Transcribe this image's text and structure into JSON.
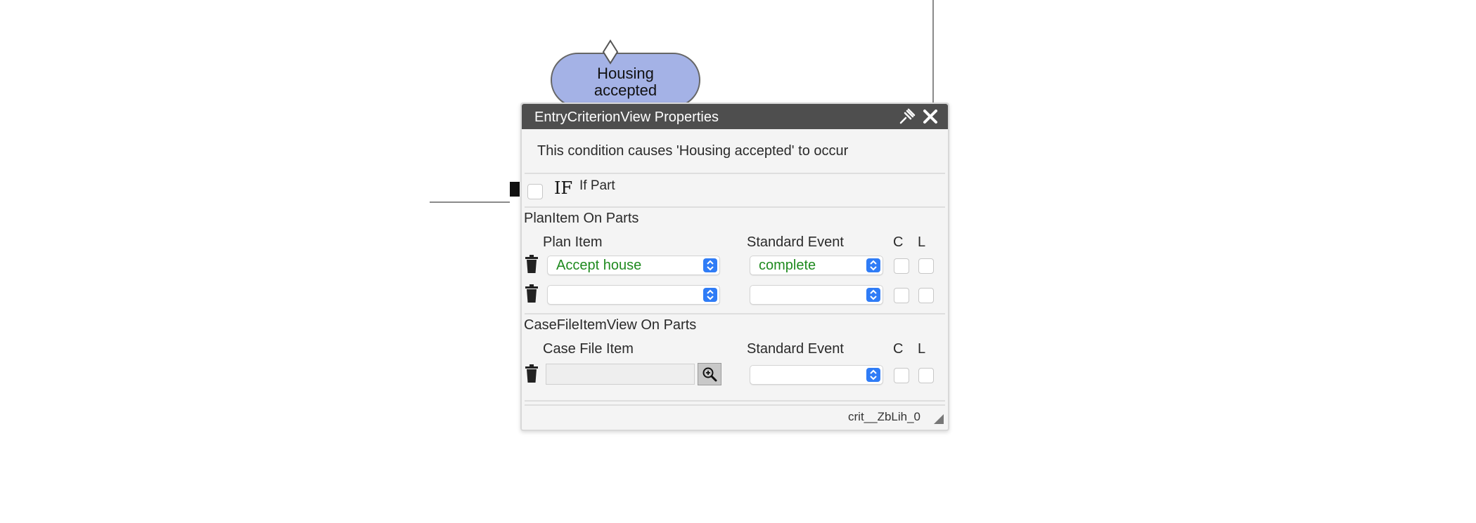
{
  "milestone": {
    "label": "Housing\naccepted",
    "fill": "#a4b2e6"
  },
  "panel": {
    "title": "EntryCriterionView Properties",
    "description": "This condition causes 'Housing accepted' to occur",
    "if_part": {
      "glyph": "IF",
      "label": "If Part",
      "checked": false
    },
    "plan_item_section": {
      "heading": "PlanItem On Parts",
      "col_plan_item": "Plan Item",
      "col_standard_event": "Standard Event",
      "col_c": "C",
      "col_l": "L",
      "rows": [
        {
          "plan_item": "Accept house",
          "standard_event": "complete"
        },
        {
          "plan_item": "",
          "standard_event": ""
        }
      ]
    },
    "case_file_section": {
      "heading": "CaseFileItemView On Parts",
      "col_case_file_item": "Case File Item",
      "col_standard_event": "Standard Event",
      "col_c": "C",
      "col_l": "L",
      "rows": [
        {
          "case_file_item": "",
          "standard_event": ""
        }
      ]
    },
    "footer_id": "crit__ZbLih_0"
  },
  "icons": [
    "pin-icon",
    "close-icon",
    "trash-icon",
    "zoom-in-icon",
    "select-stepper-icon",
    "resize-grip-icon"
  ],
  "colors": {
    "titlebar": "#4e4e4e",
    "accent": "#2f7cf6",
    "value_text": "#1f8a1f"
  }
}
